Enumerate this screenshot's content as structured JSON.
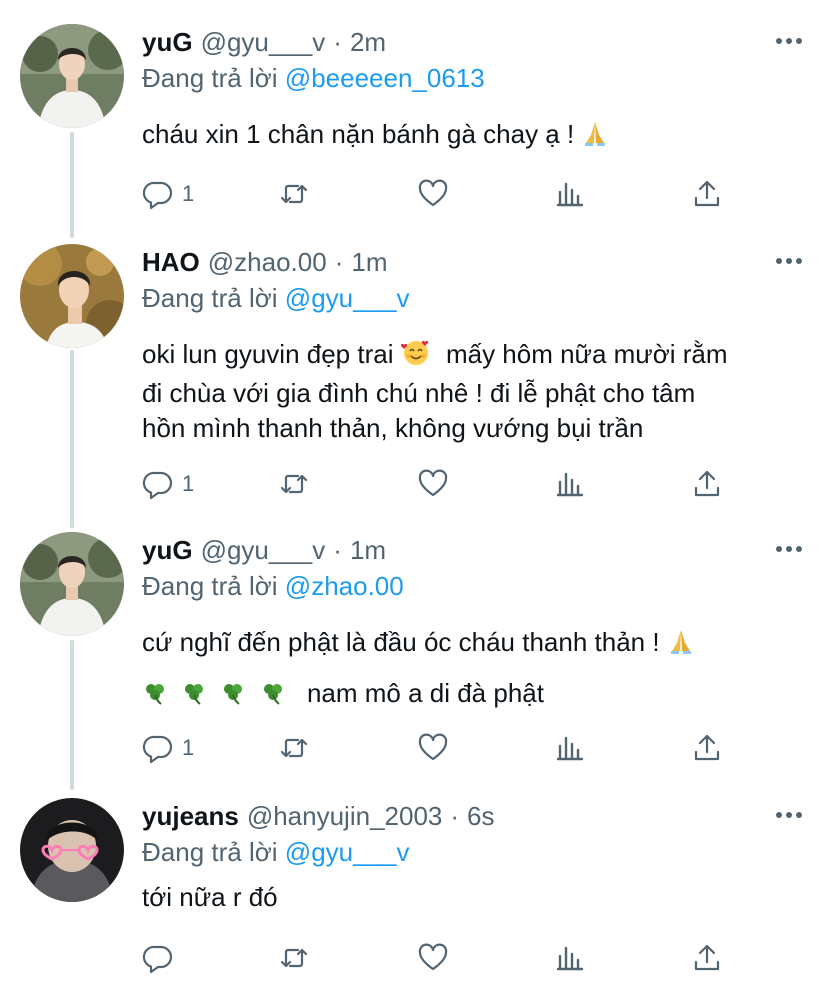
{
  "colors": {
    "accent": "#1d9bf0",
    "text": "#0f1419",
    "secondary": "#536471",
    "thread_line": "#cfd9de"
  },
  "tweets": [
    {
      "name": "yuG",
      "handle": "@gyu___v",
      "time": "2m",
      "replying_prefix": "Đang trả lời",
      "replying_to": "@beeeeen_0613",
      "lines": [
        "cháu xin 1 chân nặn bánh gà chay ạ !"
      ],
      "emoji": "folded-hands",
      "reply_count": "1"
    },
    {
      "name": "HAO",
      "handle": "@zhao.00",
      "time": "1m",
      "replying_prefix": "Đang trả lời",
      "replying_to": "@gyu___v",
      "line1_a": "oki lun gyuvin đẹp trai",
      "line1_b": "mấy hôm nữa mười rằm",
      "lines": [
        "đi chùa với gia đình chú nhê ! đi lễ phật cho tâm",
        "hồn mình thanh thản, không vướng bụi trần"
      ],
      "emoji": "smiling-face-with-hearts",
      "reply_count": "1"
    },
    {
      "name": "yuG",
      "handle": "@gyu___v",
      "time": "1m",
      "replying_prefix": "Đang trả lời",
      "replying_to": "@zhao.00",
      "lines": [
        "cứ nghĩ đến phật là đầu óc cháu thanh thản !",
        "nam mô a di đà phật"
      ],
      "emoji": "folded-hands, shamrock",
      "reply_count": "1"
    },
    {
      "name": "yujeans",
      "handle": "@hanyujin_2003",
      "time": "6s",
      "replying_prefix": "Đang trả lời",
      "replying_to": "@gyu___v",
      "lines": [
        "tới nữa r đó"
      ],
      "reply_count": ""
    }
  ],
  "separator": "·"
}
